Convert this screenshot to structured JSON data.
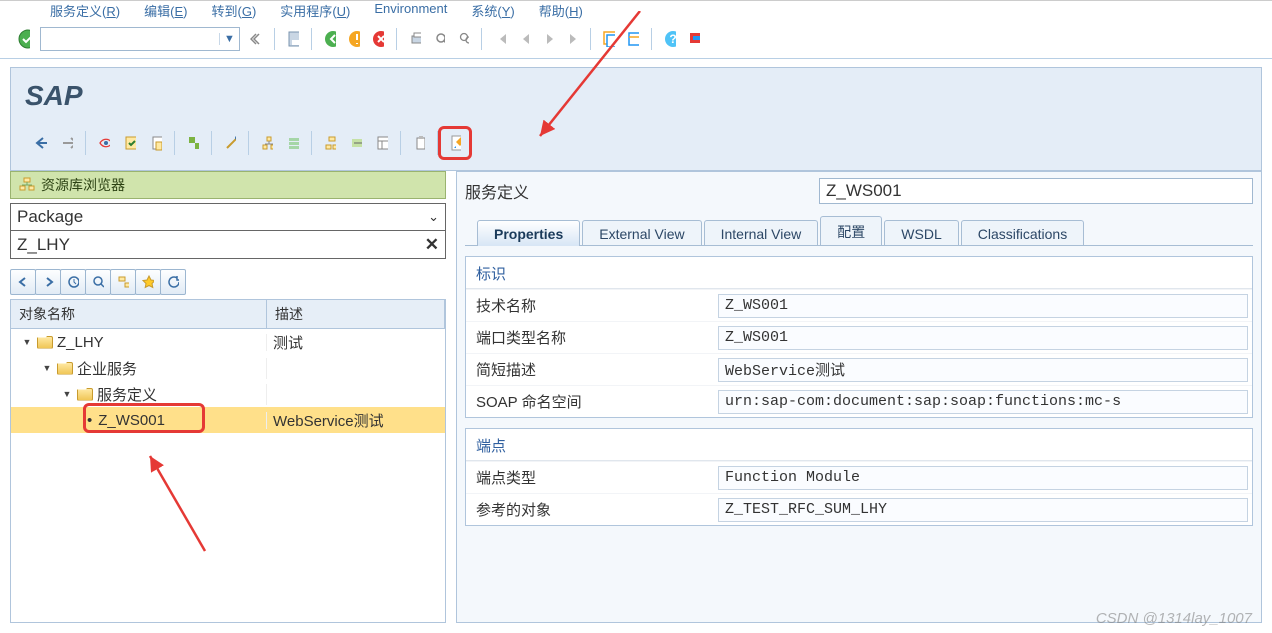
{
  "menu": [
    {
      "label": "服务定义",
      "mne": "R"
    },
    {
      "label": "编辑",
      "mne": "E"
    },
    {
      "label": "转到",
      "mne": "G"
    },
    {
      "label": "实用程序",
      "mne": "U"
    },
    {
      "label": "Environment",
      "mne": ""
    },
    {
      "label": "系统",
      "mne": "Y"
    },
    {
      "label": "帮助",
      "mne": "H"
    }
  ],
  "title": "SAP",
  "browser": {
    "header": "资源库浏览器",
    "package_select": "Package",
    "package_filter": "Z_LHY"
  },
  "tree": {
    "columns": {
      "name": "对象名称",
      "desc": "描述"
    },
    "rows": [
      {
        "level": 0,
        "kind": "open",
        "label": "Z_LHY",
        "desc": "测试"
      },
      {
        "level": 1,
        "kind": "open",
        "label": "企业服务",
        "desc": ""
      },
      {
        "level": 2,
        "kind": "open",
        "label": "服务定义",
        "desc": ""
      },
      {
        "level": 3,
        "kind": "leaf",
        "label": "Z_WS001",
        "desc": "WebService测试",
        "selected": true
      }
    ]
  },
  "header_field": {
    "label": "服务定义",
    "value": "Z_WS001"
  },
  "tabs": [
    "Properties",
    "External View",
    "Internal View",
    "配置",
    "WSDL",
    "Classifications"
  ],
  "active_tab": 0,
  "section1": {
    "title": "标识",
    "rows": [
      {
        "label": "技术名称",
        "value": "Z_WS001"
      },
      {
        "label": "端口类型名称",
        "value": "Z_WS001"
      },
      {
        "label": "简短描述",
        "value": "WebService测试"
      },
      {
        "label": "SOAP 命名空间",
        "value": "urn:sap-com:document:sap:soap:functions:mc-s"
      }
    ]
  },
  "section2": {
    "title": "端点",
    "rows": [
      {
        "label": "端点类型",
        "value": "Function Module"
      },
      {
        "label": "参考的对象",
        "value": "Z_TEST_RFC_SUM_LHY"
      }
    ]
  },
  "watermark": "CSDN @1314lay_1007"
}
